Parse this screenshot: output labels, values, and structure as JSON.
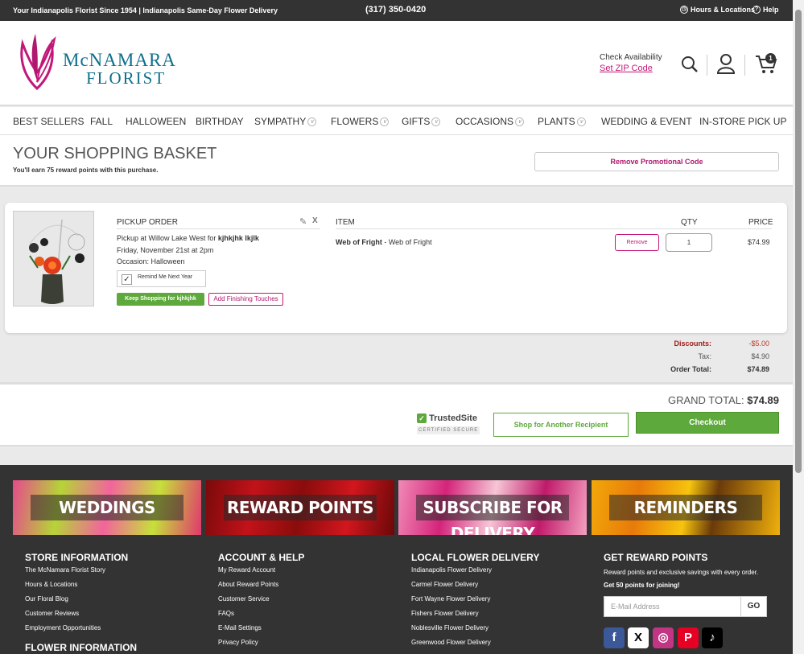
{
  "topbar": {
    "tagline": "Your Indianapolis Florist Since 1954 | Indianapolis Same-Day Flower Delivery",
    "phone": "(317) 350-0420",
    "hours": "Hours & Locations",
    "help": "Help"
  },
  "header": {
    "logo_line1": "McNAMARA",
    "logo_line2": "FLORIST",
    "check_availability": "Check Availability",
    "zip_link": "Set ZIP Code",
    "cart_count": "1"
  },
  "nav": [
    "BEST SELLERS",
    "FALL",
    "HALLOWEEN",
    "BIRTHDAY",
    "SYMPATHY",
    "FLOWERS",
    "GIFTS",
    "OCCASIONS",
    "PLANTS",
    "WEDDING & EVENT",
    "IN-STORE PICK UP"
  ],
  "basket": {
    "title": "YOUR SHOPPING BASKET",
    "subtitle": "You'll earn 75 reward points with this purchase.",
    "promo_button": "Remove Promotional Code"
  },
  "order": {
    "heading": "PICKUP ORDER",
    "pickup_prefix": "Pickup at Willow Lake West for ",
    "pickup_name": "kjhkjhk lkjlk",
    "date": "Friday, November 21st at 2pm",
    "occasion": "Occasion: Halloween",
    "remind": "Remind Me Next Year",
    "keep_shopping": "Keep Shopping for kjhkjhk",
    "finishing": "Add Finishing Touches",
    "item_header": "ITEM",
    "qty_header": "QTY",
    "price_header": "PRICE",
    "item_name_bold": "Web of Fright",
    "item_name_rest": " - Web of Fright",
    "remove": "Remove",
    "qty": "1",
    "price": "$74.99"
  },
  "totals": {
    "discounts_label": "Discounts:",
    "discounts": "-$5.00",
    "tax_label": "Tax:",
    "tax": "$4.90",
    "order_total_label": "Order Total:",
    "order_total": "$74.89"
  },
  "checkout": {
    "grand_label": "GRAND TOTAL:",
    "grand_value": "$74.89",
    "trusted": "TrustedSite",
    "trusted_sub": "CERTIFIED SECURE",
    "another": "Shop for Another Recipient",
    "checkout": "Checkout"
  },
  "footer": {
    "banners": [
      "WEDDINGS",
      "REWARD POINTS",
      "SUBSCRIBE FOR DELIVERY",
      "REMINDERS"
    ],
    "store": {
      "title": "STORE INFORMATION",
      "links": [
        "The McNamara Florist Story",
        "Hours & Locations",
        "Our Floral Blog",
        "Customer Reviews",
        "Employment Opportunities"
      ]
    },
    "account": {
      "title": "ACCOUNT & HELP",
      "links": [
        "My Reward Account",
        "About Reward Points",
        "Customer Service",
        "FAQs",
        "E-Mail Settings",
        "Privacy Policy"
      ]
    },
    "local": {
      "title": "LOCAL FLOWER DELIVERY",
      "links": [
        "Indianapolis Flower Delivery",
        "Carmel Flower Delivery",
        "Fort Wayne Flower Delivery",
        "Fishers Flower Delivery",
        "Noblesville Flower Delivery",
        "Greenwood Flower Delivery"
      ]
    },
    "reward": {
      "title": "GET REWARD POINTS",
      "text1": "Reward points and exclusive savings with every order. ",
      "text2": "Get 50 points for joining!",
      "placeholder": "E-Mail Address",
      "go": "GO"
    },
    "flower_info": "FLOWER INFORMATION"
  },
  "colors": {
    "accent_pink": "#c2187a",
    "brand_teal": "#0f6f8c",
    "green": "#5ea93b",
    "dark": "#333333"
  }
}
